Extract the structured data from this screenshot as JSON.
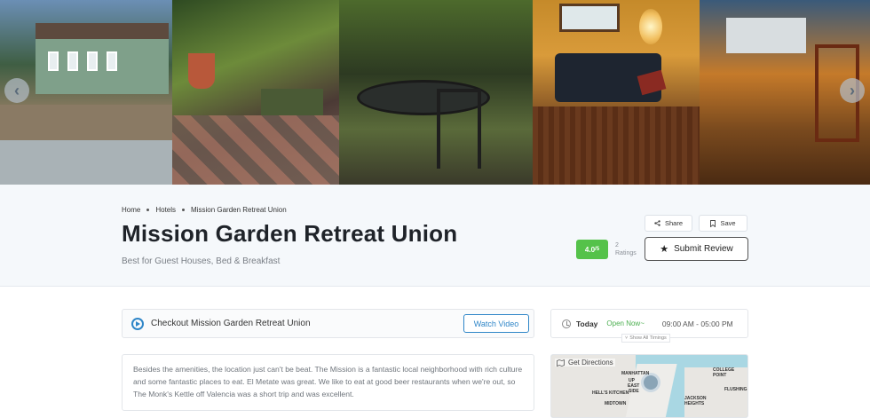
{
  "gallery": {
    "prev_label": "‹",
    "next_label": "›"
  },
  "breadcrumb": [
    "Home",
    "Hotels",
    "Mission Garden Retreat Union"
  ],
  "listing": {
    "title": "Mission Garden Retreat Union",
    "subtitle": "Best for Guest Houses, Bed & Breakfast",
    "rating": "4.0",
    "rating_max": "/5",
    "ratings_count": "2",
    "ratings_label": "Ratings"
  },
  "actions": {
    "share_label": "Share",
    "save_label": "Save",
    "review_label": "Submit Review"
  },
  "video": {
    "text": "Checkout Mission Garden Retreat Union",
    "button_label": "Watch Video"
  },
  "description": "Besides the amenities, the location just can't be beat. The Mission is a fantastic local neighborhood with rich culture and some fantastic places to eat. El Metate was great. We like to eat at good beer restaurants when we're out, so The Monk's Kettle off Valencia was a short trip and was excellent.",
  "hours": {
    "day_label": "Today",
    "status": "Open Now~",
    "times": "09:00 AM - 05:00 PM",
    "show_all": "Show All Timings"
  },
  "map": {
    "directions_label": "Get Directions",
    "labels": [
      "MANHATTAN",
      "UP",
      "EAST",
      "SIDE",
      "HELL'S KITCHEN",
      "MIDTOWN",
      "JACKSON",
      "HEIGHTS",
      "COLLEGE POINT",
      "FLUSHING"
    ]
  },
  "colors": {
    "accent_blue": "#2f86c8",
    "rating_green": "#55c24a",
    "open_green": "#4caf50"
  }
}
